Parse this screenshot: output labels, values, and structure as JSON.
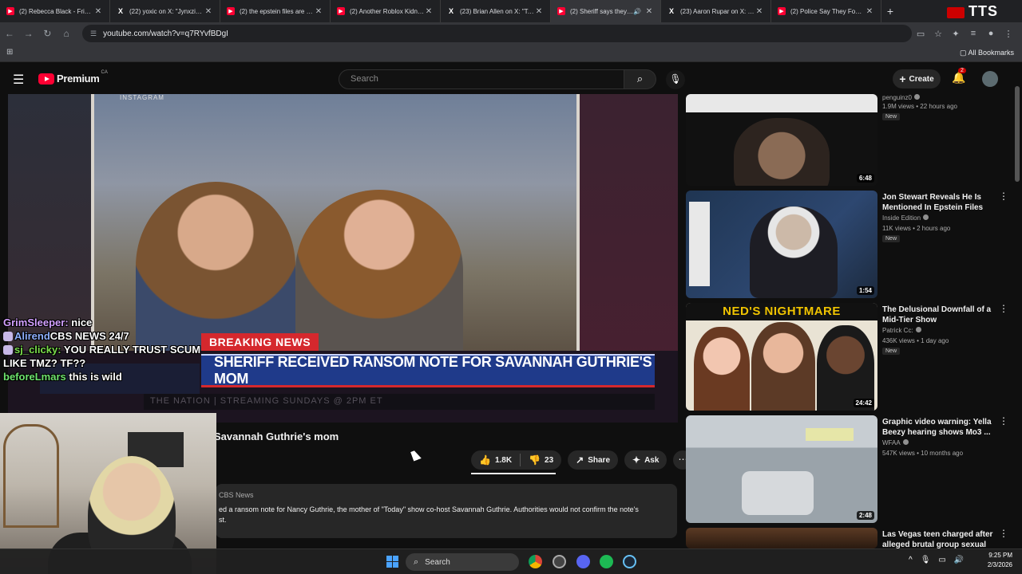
{
  "browser": {
    "tabs": [
      {
        "icon": "youtube-icon",
        "title": "(2) Rebecca Black - Friday"
      },
      {
        "icon": "x-icon",
        "title": "(22) yoxic on X: \"Jynxzi ex..."
      },
      {
        "icon": "youtube-icon",
        "title": "(2) the epstein files are g..."
      },
      {
        "icon": "youtube-icon",
        "title": "(2) Another Roblox Kidnap..."
      },
      {
        "icon": "x-icon",
        "title": "(23) Brian Allen on X: \"Tec..."
      },
      {
        "icon": "youtube-icon",
        "title": "(2) Sheriff says they re...",
        "active": true
      },
      {
        "icon": "x-icon",
        "title": "(23) Aaron Rupar on X: \"I..."
      },
      {
        "icon": "youtube-icon",
        "title": "(2) Police Say They Found..."
      }
    ],
    "new_tab_label": "+",
    "overlay_label": "TTS",
    "url": "youtube.com/watch?v=q7RYvfBDgI",
    "all_bookmarks": "All Bookmarks"
  },
  "youtube": {
    "brand": "Premium",
    "region": "CA",
    "search_placeholder": "Search",
    "create_label": "Create",
    "notifications_count": "2"
  },
  "video": {
    "source_tag": "INSTAGRAM",
    "breaking_label": "BREAKING NEWS",
    "headline": "SHERIFF RECEIVED RANSOM NOTE FOR SAVANNAH GUTHRIE'S MOM",
    "ticker": "THE NATION | STREAMING SUNDAYS @ 2PM ET",
    "title_visible": "Savannah Guthrie's mom",
    "like_count": "1.8K",
    "dislike_count": "23",
    "share_label": "Share",
    "ask_label": "Ask",
    "channel": "CBS News",
    "description": "ed a ransom note for Nancy Guthrie, the mother of \"Today\" show co-host Savannah Guthrie. Authorities would not confirm the note's",
    "description_line2": "st."
  },
  "chat": [
    {
      "user": "GrimSleeper:",
      "message": " nice"
    },
    {
      "user": "Alirend",
      "message": "CBS NEWS 24/7"
    },
    {
      "user": "sj_clicky:",
      "message": " YOU REALLY TRUST SCUM"
    },
    {
      "user": "",
      "message": "LIKE TMZ? TF??"
    },
    {
      "user": "beforeLmars",
      "message": " this is wild"
    }
  ],
  "recommendations": [
    {
      "title": "",
      "channel": "penguinz0",
      "meta": "1.9M views • 22 hours ago",
      "badge": "New",
      "duration": "6:48"
    },
    {
      "title": "Jon Stewart Reveals He Is Mentioned In Epstein Files",
      "channel": "Inside Edition",
      "meta": "11K views • 2 hours ago",
      "badge": "New",
      "duration": "1:54"
    },
    {
      "title": "The Delusional Downfall of a Mid-Tier Show",
      "channel": "Patrick Cc:",
      "meta": "436K views • 1 day ago",
      "badge": "New",
      "duration": "24:42",
      "thumb_text": "NED'S NIGHTMARE"
    },
    {
      "title": "Graphic video warning: Yella Beezy hearing shows Mo3 ...",
      "channel": "WFAA",
      "meta": "547K views • 10 months ago",
      "badge": "",
      "duration": "2:48"
    },
    {
      "title": "Las Vegas teen charged after alleged brutal group sexual ...",
      "channel": "",
      "meta": "",
      "badge": "",
      "duration": ""
    }
  ],
  "taskbar": {
    "search_label": "Search",
    "time": "9:25 PM",
    "date": "2/3/2026"
  }
}
